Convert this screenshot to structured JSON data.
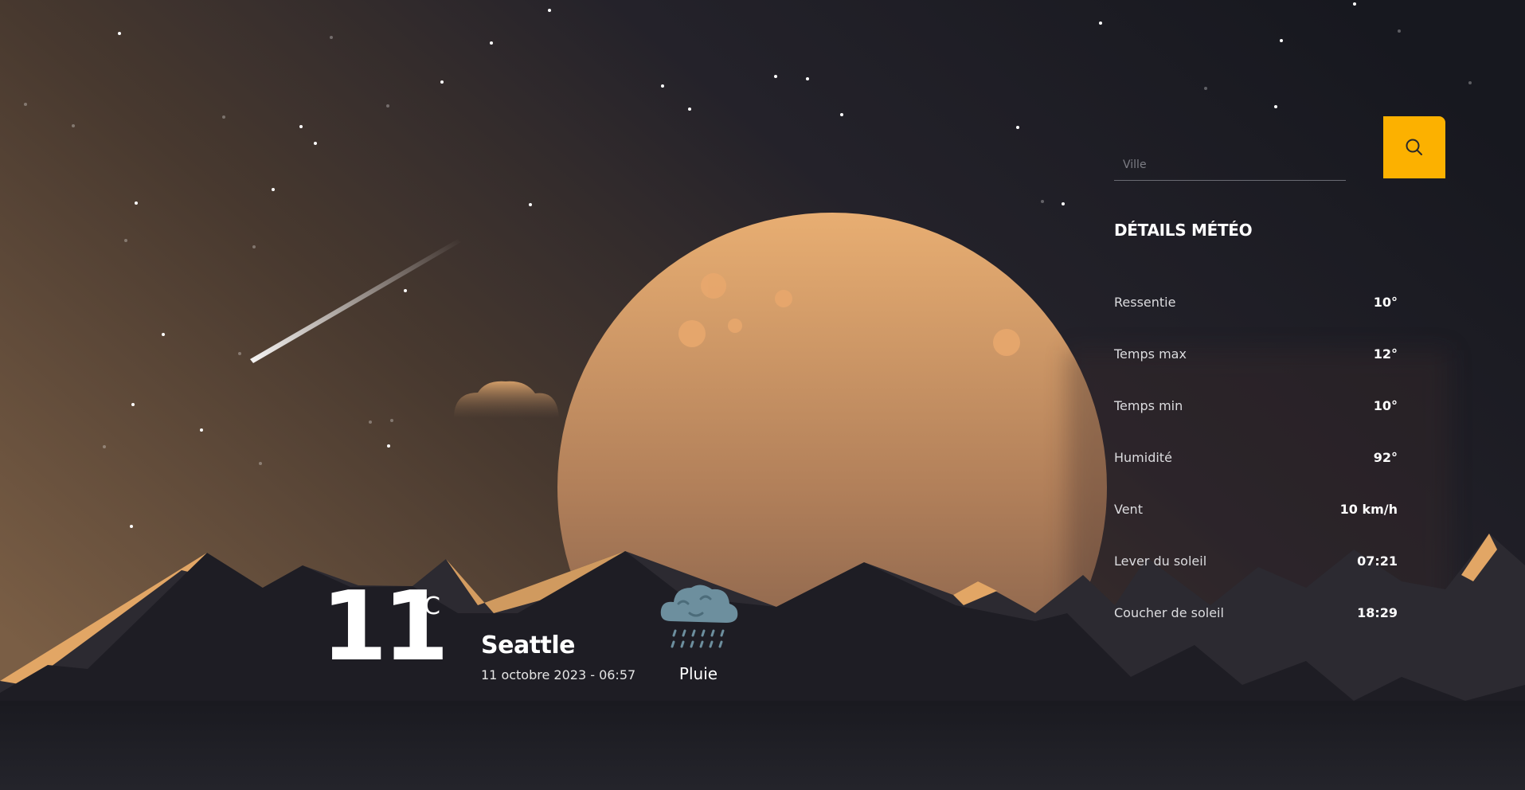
{
  "search": {
    "placeholder": "Ville",
    "value": ""
  },
  "details": {
    "title": "DÉTAILS MÉTÉO",
    "rows": [
      {
        "label": "Ressentie",
        "value": "10°"
      },
      {
        "label": "Temps max",
        "value": "12°"
      },
      {
        "label": "Temps min",
        "value": "10°"
      },
      {
        "label": "Humidité",
        "value": "92°"
      },
      {
        "label": "Vent",
        "value": "10 km/h"
      },
      {
        "label": "Lever du soleil",
        "value": "07:21"
      },
      {
        "label": "Coucher de soleil",
        "value": "18:29"
      }
    ]
  },
  "current": {
    "temperature": "11",
    "unit": "°C",
    "city": "Seattle",
    "date": "11 octobre 2023 - 06:57",
    "condition": "Pluie",
    "condition_icon": "rain-cloud-icon"
  },
  "colors": {
    "accent": "#fcb100",
    "moon": "#e0a468",
    "mountain_dark": "#1e1d24",
    "mountain_light": "#e2a665"
  }
}
